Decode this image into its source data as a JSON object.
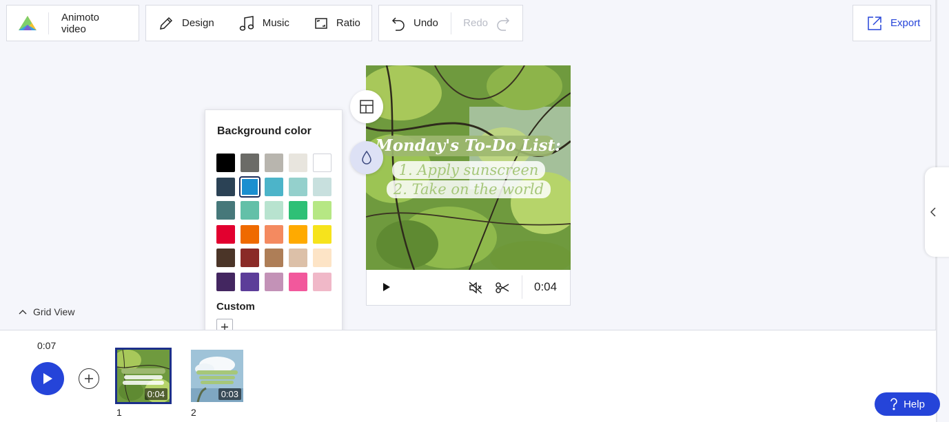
{
  "toolbar": {
    "app_label": "Animoto video",
    "design_label": "Design",
    "music_label": "Music",
    "ratio_label": "Ratio",
    "undo_label": "Undo",
    "redo_label": "Redo",
    "export_label": "Export"
  },
  "preview": {
    "title_line": "Monday's To-Do List:",
    "item_1": "1. Apply sunscreen",
    "item_2": "2. Take on the world",
    "time": "0:04"
  },
  "background_popover": {
    "title": "Background color",
    "custom_label": "Custom",
    "swatches": [
      "#000000",
      "#6b6b67",
      "#b8b5ae",
      "#e8e5de",
      "#ffffff",
      "#2b4255",
      "#1a8fd0",
      "#4cb4c9",
      "#94d0cc",
      "#c8e0de",
      "#46787a",
      "#63c0a8",
      "#b8e3cf",
      "#2ec076",
      "#b6e784",
      "#e2002f",
      "#ef6a00",
      "#f48a60",
      "#ffaa00",
      "#f6e31c",
      "#4b3528",
      "#8a2a27",
      "#ae7e57",
      "#dcc0a8",
      "#fde4c6",
      "#432660",
      "#5c3d99",
      "#c392b7",
      "#f2589c",
      "#f0b8c8"
    ],
    "selected_index": 6
  },
  "grid_view_label": "Grid View",
  "timeline": {
    "total_time": "0:07",
    "scenes": [
      {
        "number": "1",
        "duration": "0:04"
      },
      {
        "number": "2",
        "duration": "0:03"
      }
    ]
  },
  "help_label": "Help",
  "colors": {
    "accent": "#2544d9",
    "selected_outline": "#1c2f8a"
  }
}
